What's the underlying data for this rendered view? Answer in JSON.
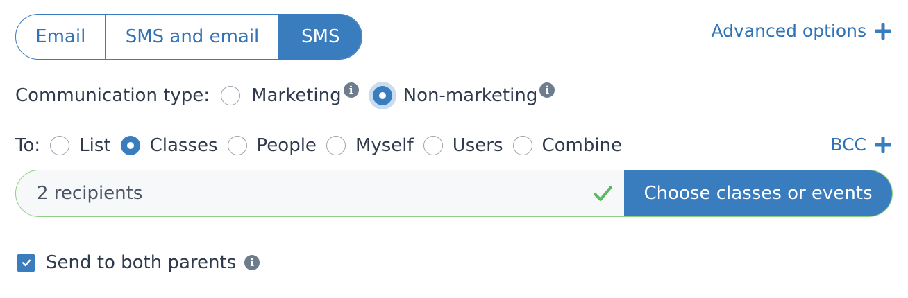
{
  "channel_tabs": [
    {
      "label": "Email",
      "active": false
    },
    {
      "label": "SMS and email",
      "active": false
    },
    {
      "label": "SMS",
      "active": true
    }
  ],
  "advanced_options": {
    "label": "Advanced options",
    "icon": "plus-icon"
  },
  "communication_type": {
    "label": "Communication type:",
    "options": [
      {
        "label": "Marketing",
        "selected": false
      },
      {
        "label": "Non-marketing",
        "selected": true
      }
    ]
  },
  "to": {
    "label": "To:",
    "options": [
      {
        "label": "List",
        "selected": false
      },
      {
        "label": "Classes",
        "selected": true
      },
      {
        "label": "People",
        "selected": false
      },
      {
        "label": "Myself",
        "selected": false
      },
      {
        "label": "Users",
        "selected": false
      },
      {
        "label": "Combine",
        "selected": false
      }
    ]
  },
  "bcc": {
    "label": "BCC",
    "icon": "plus-icon"
  },
  "recipients": {
    "value": "2 recipients",
    "status_icon": "checkmark-icon",
    "button_label": "Choose classes or events"
  },
  "send_to_both_parents": {
    "label": "Send to both parents",
    "checked": true
  },
  "info_glyph": "i",
  "colors": {
    "accent": "#3a7dbf",
    "valid_border": "#8fcf86",
    "valid_check": "#5cb85c",
    "info_icon": "#6d7d8e"
  }
}
